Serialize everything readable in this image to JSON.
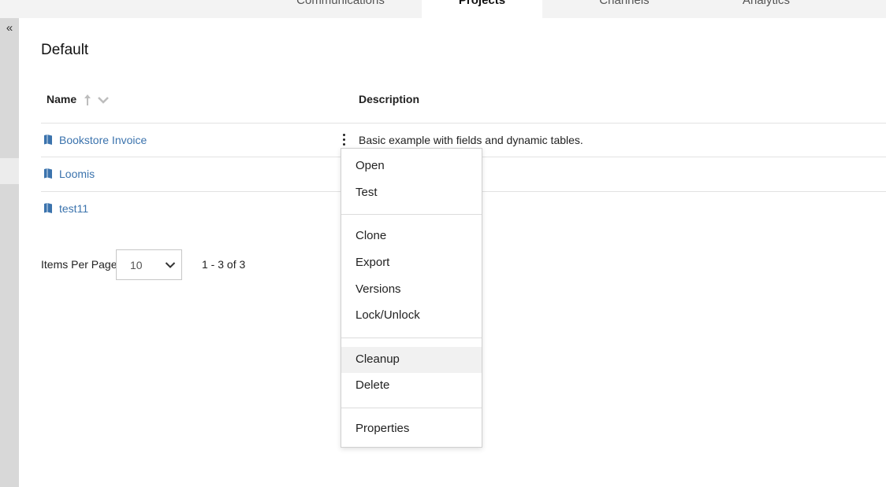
{
  "tabs": [
    {
      "label": "Communications",
      "active": false
    },
    {
      "label": "Projects",
      "active": true
    },
    {
      "label": "Channels",
      "active": false
    },
    {
      "label": "Analytics",
      "active": false
    }
  ],
  "sidebar": {
    "collapse_glyph": "«"
  },
  "page": {
    "title": "Default"
  },
  "table": {
    "columns": {
      "name": "Name",
      "description": "Description"
    },
    "rows": [
      {
        "name": "Bookstore Invoice",
        "description": "Basic example with fields and dynamic tables."
      },
      {
        "name": "Loomis",
        "description": ""
      },
      {
        "name": "test11",
        "description": ""
      }
    ]
  },
  "pagination": {
    "label": "Items Per Page",
    "per_page": "10",
    "range": "1 - 3 of 3"
  },
  "context_menu": {
    "items": [
      "Open",
      "Test",
      "Clone",
      "Export",
      "Versions",
      "Lock/Unlock",
      "Cleanup",
      "Delete",
      "Properties"
    ],
    "hovered": "Cleanup"
  },
  "colors": {
    "link": "#3b73ad",
    "icon": "#3b73ad",
    "rail": "#d8d8d8"
  },
  "icons": {
    "project": "book-icon",
    "sort_asc": "sort-ascending-icon",
    "sort_menu": "chevron-down-icon",
    "select": "chevron-down-icon",
    "actions": "kebab-menu-icon"
  }
}
